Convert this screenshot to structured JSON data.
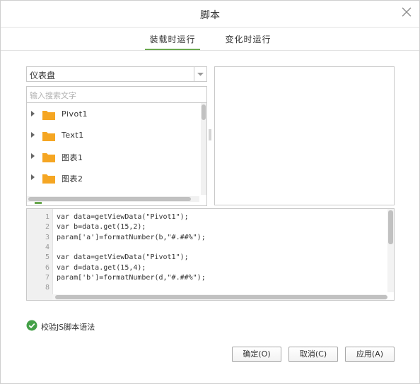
{
  "dialog": {
    "title": "脚本"
  },
  "tabs": [
    {
      "label": "装载时运行",
      "active": true
    },
    {
      "label": "变化时运行",
      "active": false
    }
  ],
  "source_select": {
    "value": "仪表盘"
  },
  "search": {
    "placeholder": "输入搜索文字"
  },
  "tree": {
    "items": [
      {
        "label": "Pivot1",
        "icon": "folder-icon"
      },
      {
        "label": "Text1",
        "icon": "folder-icon"
      },
      {
        "label": "图表1",
        "icon": "folder-icon"
      },
      {
        "label": "图表2",
        "icon": "folder-icon"
      }
    ]
  },
  "editor": {
    "line_numbers": [
      "1",
      "2",
      "3",
      "4",
      "5",
      "6",
      "7",
      "8"
    ],
    "lines": [
      "var data=getViewData(\"Pivot1\");",
      "var b=data.get(15,2);",
      "param['a']=formatNumber(b,\"#.##%\");",
      "",
      "var data=getViewData(\"Pivot1\");",
      "var d=data.get(15,4);",
      "param['b']=formatNumber(d,\"#.##%\");",
      ""
    ]
  },
  "validate": {
    "label": "校验JS脚本语法",
    "checked": true
  },
  "buttons": {
    "ok": "确定(O)",
    "cancel": "取消(C)",
    "apply": "应用(A)"
  },
  "colors": {
    "accent": "#6aa84f",
    "folder": "#f5a623",
    "check": "#43a047"
  }
}
